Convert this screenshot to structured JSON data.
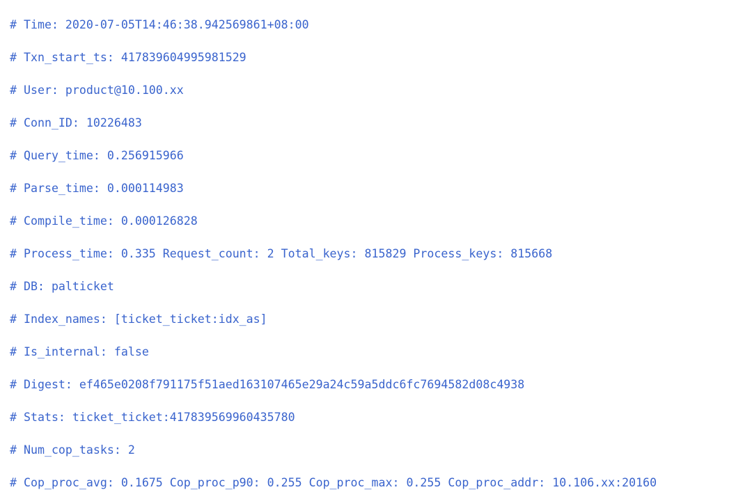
{
  "document": {
    "type": "slow-query-log",
    "text_color": "#3a64cd",
    "background_color": "#ffffff",
    "comment_prefix": "#",
    "lines": [
      {
        "key": "Time",
        "text": "# Time: 2020-07-05T14:46:38.942569861+08:00"
      },
      {
        "key": "Txn_start_ts",
        "text": "# Txn_start_ts: 417839604995981529"
      },
      {
        "key": "User",
        "text": "# User: product@10.100.xx"
      },
      {
        "key": "Conn_ID",
        "text": "# Conn_ID: 10226483"
      },
      {
        "key": "Query_time",
        "text": "# Query_time: 0.256915966"
      },
      {
        "key": "Parse_time",
        "text": "# Parse_time: 0.000114983"
      },
      {
        "key": "Compile_time",
        "text": "# Compile_time: 0.000126828"
      },
      {
        "key": "Process_time",
        "text": "# Process_time: 0.335 Request_count: 2 Total_keys: 815829 Process_keys: 815668"
      },
      {
        "key": "DB",
        "text": "# DB: palticket"
      },
      {
        "key": "Index_names",
        "text": "# Index_names: [ticket_ticket:idx_as]"
      },
      {
        "key": "Is_internal",
        "text": "# Is_internal: false"
      },
      {
        "key": "Digest",
        "text": "# Digest: ef465e0208f791175f51aed163107465e29a24c59a5ddc6fc7694582d08c4938"
      },
      {
        "key": "Stats",
        "text": "# Stats: ticket_ticket:417839569960435780"
      },
      {
        "key": "Num_cop_tasks",
        "text": "# Num_cop_tasks: 2"
      },
      {
        "key": "Cop_proc",
        "text": "# Cop_proc_avg: 0.1675 Cop_proc_p90: 0.255 Cop_proc_max: 0.255 Cop_proc_addr: 10.106.xx:20160"
      }
    ],
    "fields": {
      "Time": "2020-07-05T14:46:38.942569861+08:00",
      "Txn_start_ts": "417839604995981529",
      "User": "product@10.100.xx",
      "Conn_ID": "10226483",
      "Query_time": "0.256915966",
      "Parse_time": "0.000114983",
      "Compile_time": "0.000126828",
      "Process_time": "0.335",
      "Request_count": "2",
      "Total_keys": "815829",
      "Process_keys": "815668",
      "DB": "palticket",
      "Index_names": "[ticket_ticket:idx_as]",
      "Is_internal": "false",
      "Digest": "ef465e0208f791175f51aed163107465e29a24c59a5ddc6fc7694582d08c4938",
      "Stats": "ticket_ticket:417839569960435780",
      "Num_cop_tasks": "2",
      "Cop_proc_avg": "0.1675",
      "Cop_proc_p90": "0.255",
      "Cop_proc_max": "0.255",
      "Cop_proc_addr": "10.106.xx:20160"
    }
  }
}
